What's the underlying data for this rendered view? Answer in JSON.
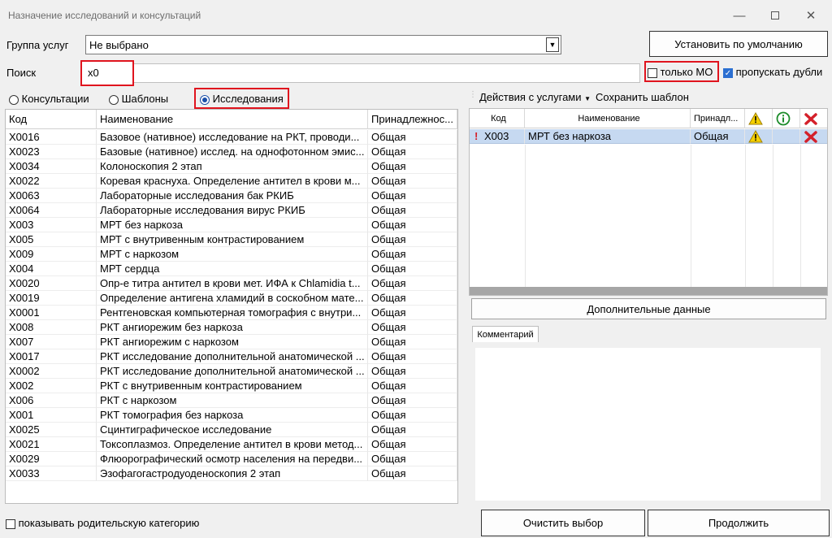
{
  "window": {
    "title": "Назначение исследований и консультаций"
  },
  "group": {
    "label": "Группа услуг",
    "value": "Не выбрано"
  },
  "default_button": "Установить по умолчанию",
  "search": {
    "label": "Поиск",
    "value": "x0"
  },
  "only_mo": {
    "label": "только МО",
    "checked": false
  },
  "skip_dupes": {
    "label": "пропускать дубли",
    "checked": true
  },
  "radios": [
    {
      "label": "Консультации",
      "selected": false
    },
    {
      "label": "Шаблоны",
      "selected": false
    },
    {
      "label": "Исследования",
      "selected": true
    }
  ],
  "services": {
    "columns": [
      "Код",
      "Наименование",
      "Принадлежнос..."
    ],
    "rows": [
      [
        "X0016",
        "Базовое (нативное) исследование на РКТ, проводи...",
        "Общая"
      ],
      [
        "X0023",
        "Базовые (нативное) исслед. на однофотонном эмис...",
        "Общая"
      ],
      [
        "X0034",
        "Колоноскопия 2 этап",
        "Общая"
      ],
      [
        "X0022",
        "Коревая краснуха. Определение антител в крови м...",
        "Общая"
      ],
      [
        "X0063",
        "Лабораторные исследования бак РКИБ",
        "Общая"
      ],
      [
        "X0064",
        "Лабораторные исследования вирус РКИБ",
        "Общая"
      ],
      [
        "X003",
        "МРТ без наркоза",
        "Общая"
      ],
      [
        "X005",
        "МРТ с внутривенным  контрастированием",
        "Общая"
      ],
      [
        "X009",
        "МРТ с наркозом",
        "Общая"
      ],
      [
        "X004",
        "МРТ сердца",
        "Общая"
      ],
      [
        "X0020",
        "Опр-е титра антител в крови мет. ИФА к Chlamidia t...",
        "Общая"
      ],
      [
        "X0019",
        "Определение антигена хламидий в соскобном мате...",
        "Общая"
      ],
      [
        "X0001",
        "Рентгеновская компьютерная томография с внутри...",
        "Общая"
      ],
      [
        "X008",
        "РКТ ангиорежим без наркоза",
        "Общая"
      ],
      [
        "X007",
        "РКТ ангиорежим с наркозом",
        "Общая"
      ],
      [
        "X0017",
        "РКТ исследование дополнительной анатомической ...",
        "Общая"
      ],
      [
        "X0002",
        "РКТ исследование дополнительной анатомической ...",
        "Общая"
      ],
      [
        "X002",
        "РКТ с внутривенным контрастированием",
        "Общая"
      ],
      [
        "X006",
        "РКТ с наркозом",
        "Общая"
      ],
      [
        "X001",
        "РКТ томография без наркоза",
        "Общая"
      ],
      [
        "X0025",
        "Сцинтиграфическое исследование",
        "Общая"
      ],
      [
        "X0021",
        "Токсоплазмоз. Определение антител в крови метод...",
        "Общая"
      ],
      [
        "X0029",
        "Флюорографический осмотр населения на передви...",
        "Общая"
      ],
      [
        "X0033",
        "Эзофагогастродуоденоскопия 2 этап",
        "Общая"
      ]
    ]
  },
  "toolbar": {
    "actions": "Действия с услугами",
    "save_template": "Сохранить шаблон"
  },
  "selected": {
    "columns": [
      "Код",
      "Наименование",
      "Принадл..."
    ],
    "rows": [
      {
        "flag": "!",
        "code": "X003",
        "name": "МРТ без наркоза",
        "belong": "Общая"
      }
    ]
  },
  "extra_button": "Дополнительные данные",
  "comment_tab": "Комментарий",
  "show_parent": {
    "label": "показывать родительскую категорию",
    "checked": false
  },
  "clear_button": "Очистить выбор",
  "continue_button": "Продолжить"
}
